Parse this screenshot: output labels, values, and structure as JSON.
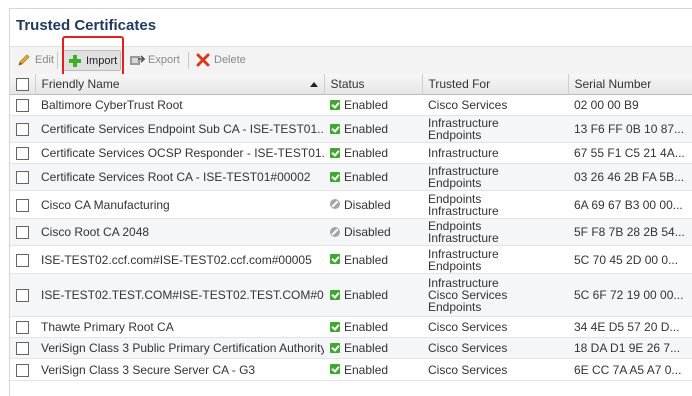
{
  "page": {
    "title": "Trusted Certificates"
  },
  "toolbar": {
    "edit_label": "Edit",
    "import_label": "Import",
    "export_label": "Export",
    "delete_label": "Delete"
  },
  "table": {
    "headers": {
      "friendly_name": "Friendly Name",
      "status": "Status",
      "trusted_for": "Trusted For",
      "serial_number": "Serial Number"
    },
    "sort": {
      "column": "friendly_name",
      "direction": "ascending"
    },
    "rows": [
      {
        "name": "Baltimore CyberTrust Root",
        "status": "Enabled",
        "status_type": "enabled",
        "trusted_for": [
          "Cisco Services"
        ],
        "serial": "02 00 00 B9"
      },
      {
        "name": "Certificate Services Endpoint Sub CA - ISE-TEST01...",
        "status": "Enabled",
        "status_type": "enabled",
        "trusted_for": [
          "Infrastructure",
          "Endpoints"
        ],
        "serial": "13 F6 FF 0B 10 87..."
      },
      {
        "name": "Certificate Services OCSP Responder - ISE-TEST01...",
        "status": "Enabled",
        "status_type": "enabled",
        "trusted_for": [
          "Infrastructure"
        ],
        "serial": "67 55 F1 C5 21 4A..."
      },
      {
        "name": "Certificate Services Root CA - ISE-TEST01#00002",
        "status": "Enabled",
        "status_type": "enabled",
        "trusted_for": [
          "Infrastructure",
          "Endpoints"
        ],
        "serial": "03 26 46 2B FA 5B..."
      },
      {
        "name": "Cisco CA Manufacturing",
        "status": "Disabled",
        "status_type": "disabled",
        "trusted_for": [
          "Endpoints",
          "Infrastructure"
        ],
        "serial": "6A 69 67 B3 00 00..."
      },
      {
        "name": "Cisco Root CA 2048",
        "status": "Disabled",
        "status_type": "disabled",
        "trusted_for": [
          "Endpoints",
          "Infrastructure"
        ],
        "serial": "5F F8 7B 28 2B 54..."
      },
      {
        "name": "ISE-TEST02.ccf.com#ISE-TEST02.ccf.com#00005",
        "status": "Enabled",
        "status_type": "enabled",
        "trusted_for": [
          "Infrastructure",
          "Endpoints"
        ],
        "serial": "5C 70 45 2D 00 0..."
      },
      {
        "name": "ISE-TEST02.TEST.COM#ISE-TEST02.TEST.COM#0...",
        "status": "Enabled",
        "status_type": "enabled",
        "trusted_for": [
          "Infrastructure",
          "Cisco Services",
          "Endpoints"
        ],
        "serial": "5C 6F 72 19 00 00..."
      },
      {
        "name": "Thawte Primary Root CA",
        "status": "Enabled",
        "status_type": "enabled",
        "trusted_for": [
          "Cisco Services"
        ],
        "serial": "34 4E D5 57 20 D..."
      },
      {
        "name": "VeriSign Class 3 Public Primary Certification Authority",
        "status": "Enabled",
        "status_type": "enabled",
        "trusted_for": [
          "Cisco Services"
        ],
        "serial": "18 DA D1 9E 26 7..."
      },
      {
        "name": "VeriSign Class 3 Secure Server CA - G3",
        "status": "Enabled",
        "status_type": "enabled",
        "trusted_for": [
          "Cisco Services"
        ],
        "serial": "6E CC 7A A5 A7 0..."
      }
    ]
  },
  "colors": {
    "title": "#1f3a5c",
    "highlight": "#e02020",
    "enabled": "#3ea82f",
    "disabled": "#a5a5a5"
  }
}
